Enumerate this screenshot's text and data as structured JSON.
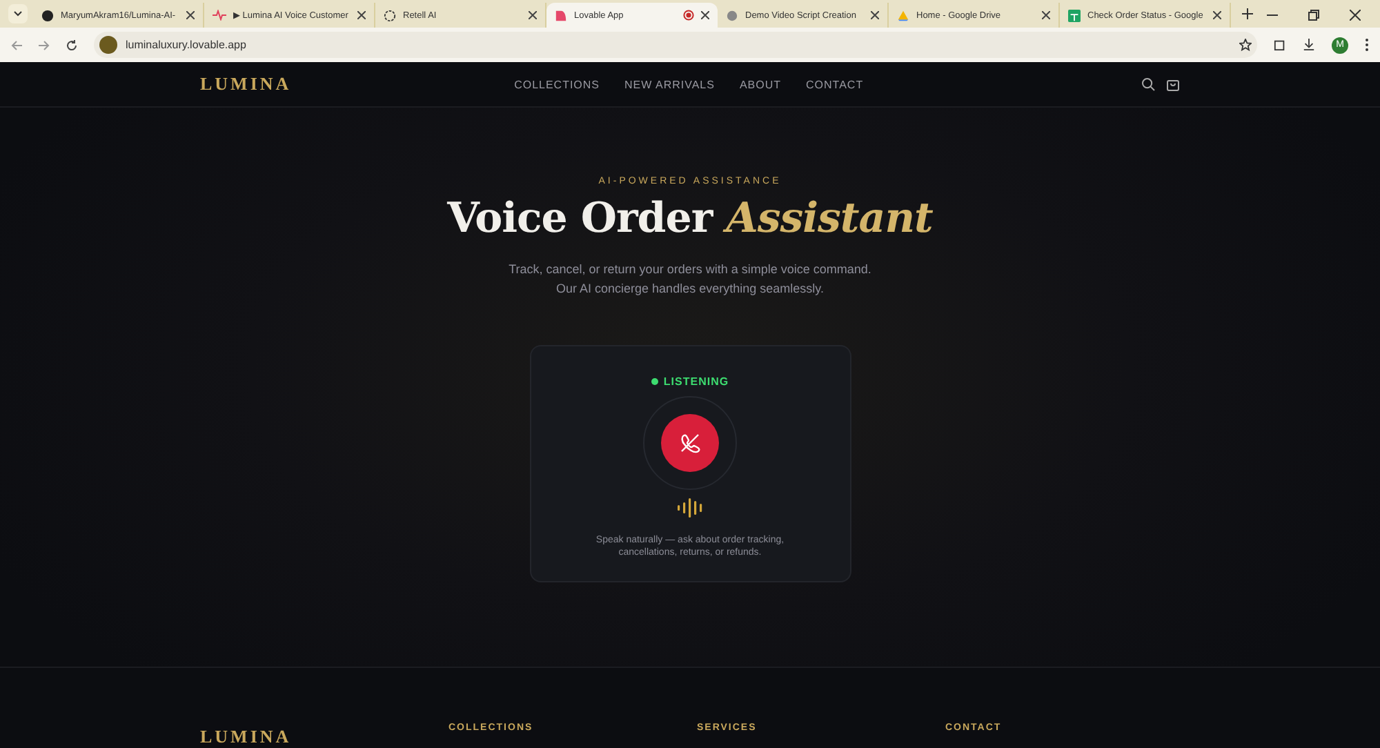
{
  "browser": {
    "tabs": [
      {
        "title": "MaryumAkram16/Lumina-AI-",
        "selected": false
      },
      {
        "title": "▶ Lumina AI Voice Customer",
        "selected": false
      },
      {
        "title": "Retell AI",
        "selected": false
      },
      {
        "title": "Lovable App",
        "selected": true,
        "recording": true
      },
      {
        "title": "Demo Video Script Creation",
        "selected": false
      },
      {
        "title": "Home - Google Drive",
        "selected": false
      },
      {
        "title": "Check Order Status - Google",
        "selected": false
      }
    ],
    "url": "luminaluxury.lovable.app",
    "profile": "M"
  },
  "nav": {
    "logo": "LUMINA",
    "links": [
      "COLLECTIONS",
      "NEW ARRIVALS",
      "ABOUT",
      "CONTACT"
    ]
  },
  "hero": {
    "eyebrow": "AI-POWERED ASSISTANCE",
    "title": "Voice Order",
    "title_accent": "Assistant",
    "subtitle_lines": [
      "Track, cancel, or return your orders with a simple voice command.",
      "Our AI concierge handles everything seamlessly."
    ]
  },
  "assistant": {
    "status": "LISTENING",
    "listening": true,
    "hint": "Speak naturally — ask about order tracking, cancellations, returns, or refunds."
  },
  "footer": {
    "logo": "LUMINA",
    "headings": [
      "COLLECTIONS",
      "SERVICES",
      "CONTACT"
    ]
  }
}
